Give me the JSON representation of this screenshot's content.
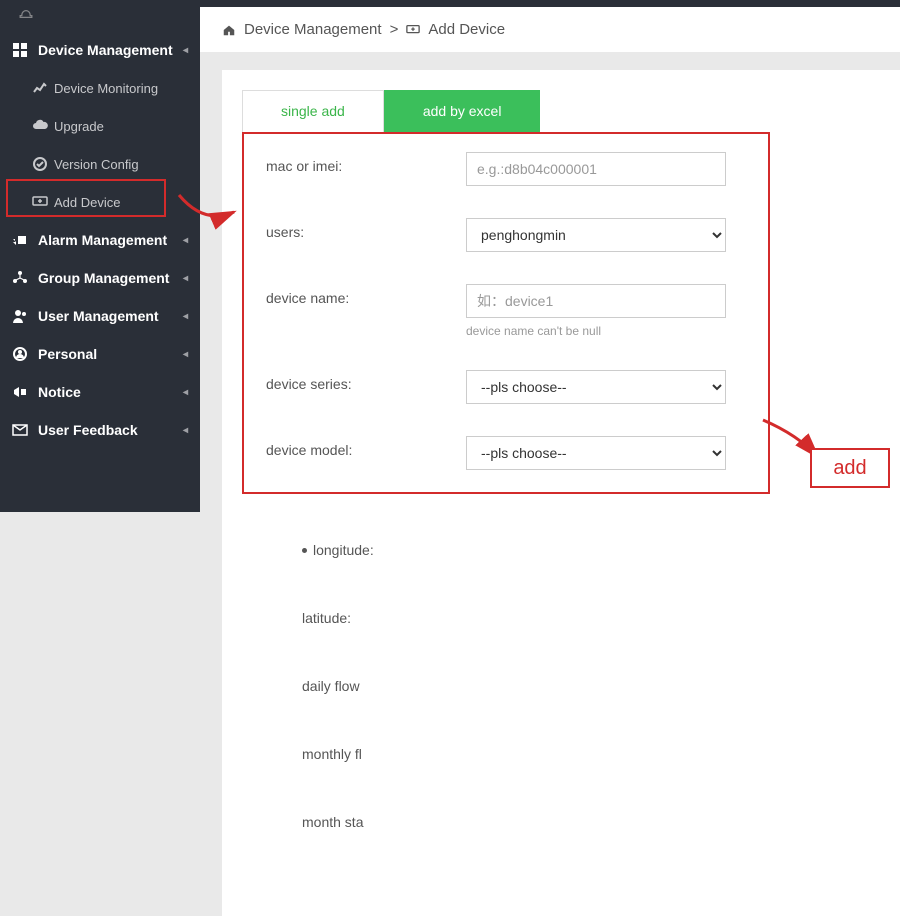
{
  "sidebar": {
    "items": [
      {
        "label": "Device Management"
      },
      {
        "label": "Device Monitoring"
      },
      {
        "label": "Upgrade"
      },
      {
        "label": "Version Config"
      },
      {
        "label": "Add Device"
      },
      {
        "label": "Alarm Management"
      },
      {
        "label": "Group Management"
      },
      {
        "label": "User Management"
      },
      {
        "label": "Personal"
      },
      {
        "label": "Notice"
      },
      {
        "label": "User Feedback"
      }
    ]
  },
  "breadcrumb": {
    "part1": "Device Management",
    "sep": ">",
    "part2": "Add Device"
  },
  "tabs": {
    "single": "single add",
    "excel": "add by excel"
  },
  "form": {
    "mac_label": "mac or imei:",
    "mac_placeholder": "e.g.:d8b04c000001",
    "users_label": "users:",
    "users_value": "penghongmin",
    "devicename_label": "device name:",
    "devicename_placeholder": "如：device1",
    "devicename_hint": "device name can't be null",
    "series_label": "device series:",
    "series_value": "--pls choose--",
    "model_label": "device model:",
    "model_value": "--pls choose--"
  },
  "right": {
    "longitude": "longitude:",
    "latitude": "latitude:",
    "daily": "daily flow",
    "monthly": "monthly fl",
    "month_sta": "month sta"
  },
  "annotation": {
    "add": "add"
  }
}
